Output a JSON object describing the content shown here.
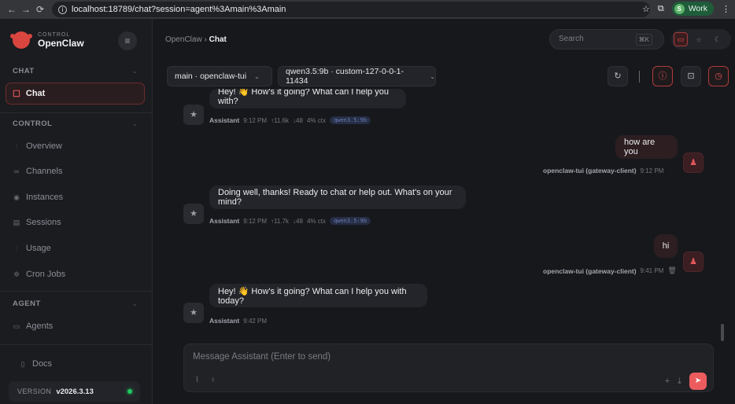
{
  "browser": {
    "url": "localhost:18789/chat?session=agent%3Amain%3Amain",
    "profile_initial": "S",
    "profile_label": "Work"
  },
  "sidebar": {
    "brand_small": "CONTROL",
    "brand_name": "OpenClaw",
    "sections": [
      {
        "title": "CHAT"
      },
      {
        "title": "CONTROL"
      },
      {
        "title": "AGENT"
      }
    ],
    "chat_item": "Chat",
    "control_items": [
      "Overview",
      "Channels",
      "Instances",
      "Sessions",
      "Usage",
      "Cron Jobs"
    ],
    "agent_items": [
      "Agents"
    ],
    "docs": "Docs",
    "version_label": "VERSION",
    "version_value": "v2026.3.13"
  },
  "header": {
    "crumb_root": "OpenClaw",
    "crumb_sep": "›",
    "crumb_current": "Chat",
    "search_placeholder": "Search",
    "search_shortcut": "⌘K"
  },
  "toolbar": {
    "session_select": "main · openclaw-tui",
    "model_select": "qwen3.5:9b · custom-127-0-0-1-11434"
  },
  "messages": [
    {
      "role": "assistant",
      "text": "Hey! 👋 How's it going? What can I help you with?",
      "sender": "Assistant",
      "time": "9:12 PM",
      "tokens_in": "↑11.6k",
      "tokens_out": "↓48",
      "ctx": "4% ctx",
      "model": "qwen3.5:9b"
    },
    {
      "role": "user",
      "text": "how are you",
      "sender": "openclaw-tui (gateway-client)",
      "time": "9:12 PM"
    },
    {
      "role": "assistant",
      "text": "Doing well, thanks! Ready to chat or help out. What's on your mind?",
      "sender": "Assistant",
      "time": "9:12 PM",
      "tokens_in": "↑11.7k",
      "tokens_out": "↓48",
      "ctx": "4% ctx",
      "model": "qwen3.5:9b"
    },
    {
      "role": "user",
      "text": "hi",
      "sender": "openclaw-tui (gateway-client)",
      "time": "9:41 PM"
    },
    {
      "role": "assistant",
      "text": "Hey! 👋 How's it going? What can I help you with today?",
      "sender": "Assistant",
      "time": "9:42 PM"
    }
  ],
  "composer": {
    "placeholder": "Message Assistant (Enter to send)"
  }
}
